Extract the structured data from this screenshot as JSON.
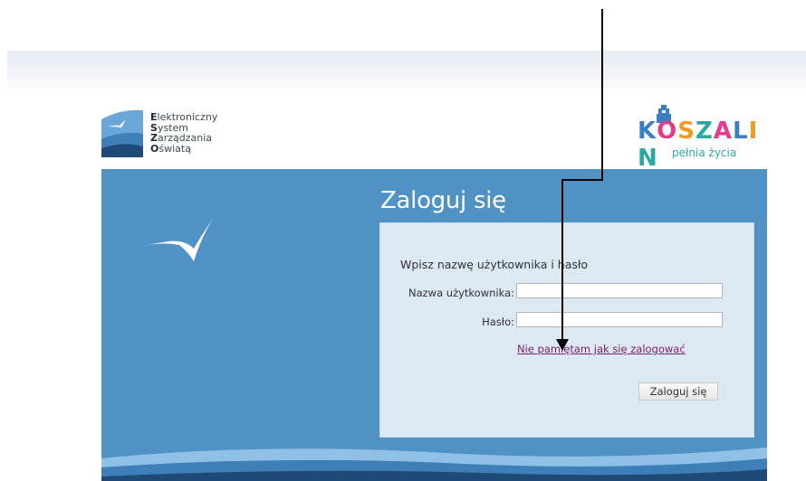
{
  "header": {
    "eszo_logo": {
      "icon": "eszo-logo-icon",
      "lines": [
        {
          "initial": "E",
          "rest": "lektroniczny"
        },
        {
          "initial": "S",
          "rest": "ystem"
        },
        {
          "initial": "Z",
          "rest": "arządzania"
        },
        {
          "initial": "O",
          "rest": "światą"
        }
      ]
    },
    "koszalin_logo": {
      "word": "KOSZALIN",
      "tagline": "pełnia życia",
      "letter_colors": [
        "#3a7fc4",
        "#e83a8c",
        "#f29a1f",
        "#2aa9a0",
        "#e83a8c",
        "#3a7fc4",
        "#f29a1f",
        "#2aa9a0"
      ]
    }
  },
  "main": {
    "bird_icon": "seagull-icon",
    "heading": "Zaloguj się",
    "login_box": {
      "prompt": "Wpisz nazwę użytkownika i hasło",
      "username_label": "Nazwa użytkownika:",
      "username_value": "",
      "password_label": "Hasło:",
      "password_value": "",
      "forgot_link": "Nie pamiętam jak się zalogować",
      "submit_label": "Zaloguj się"
    }
  },
  "colors": {
    "panel_blue": "#5192c5",
    "box_bg": "#dce8f2",
    "link": "#7a1f6b",
    "wave_dark": "#1f4a78",
    "wave_light": "#8fc1e6"
  },
  "annotation": {
    "type": "arrow",
    "icon": "pointer-arrow-icon"
  }
}
